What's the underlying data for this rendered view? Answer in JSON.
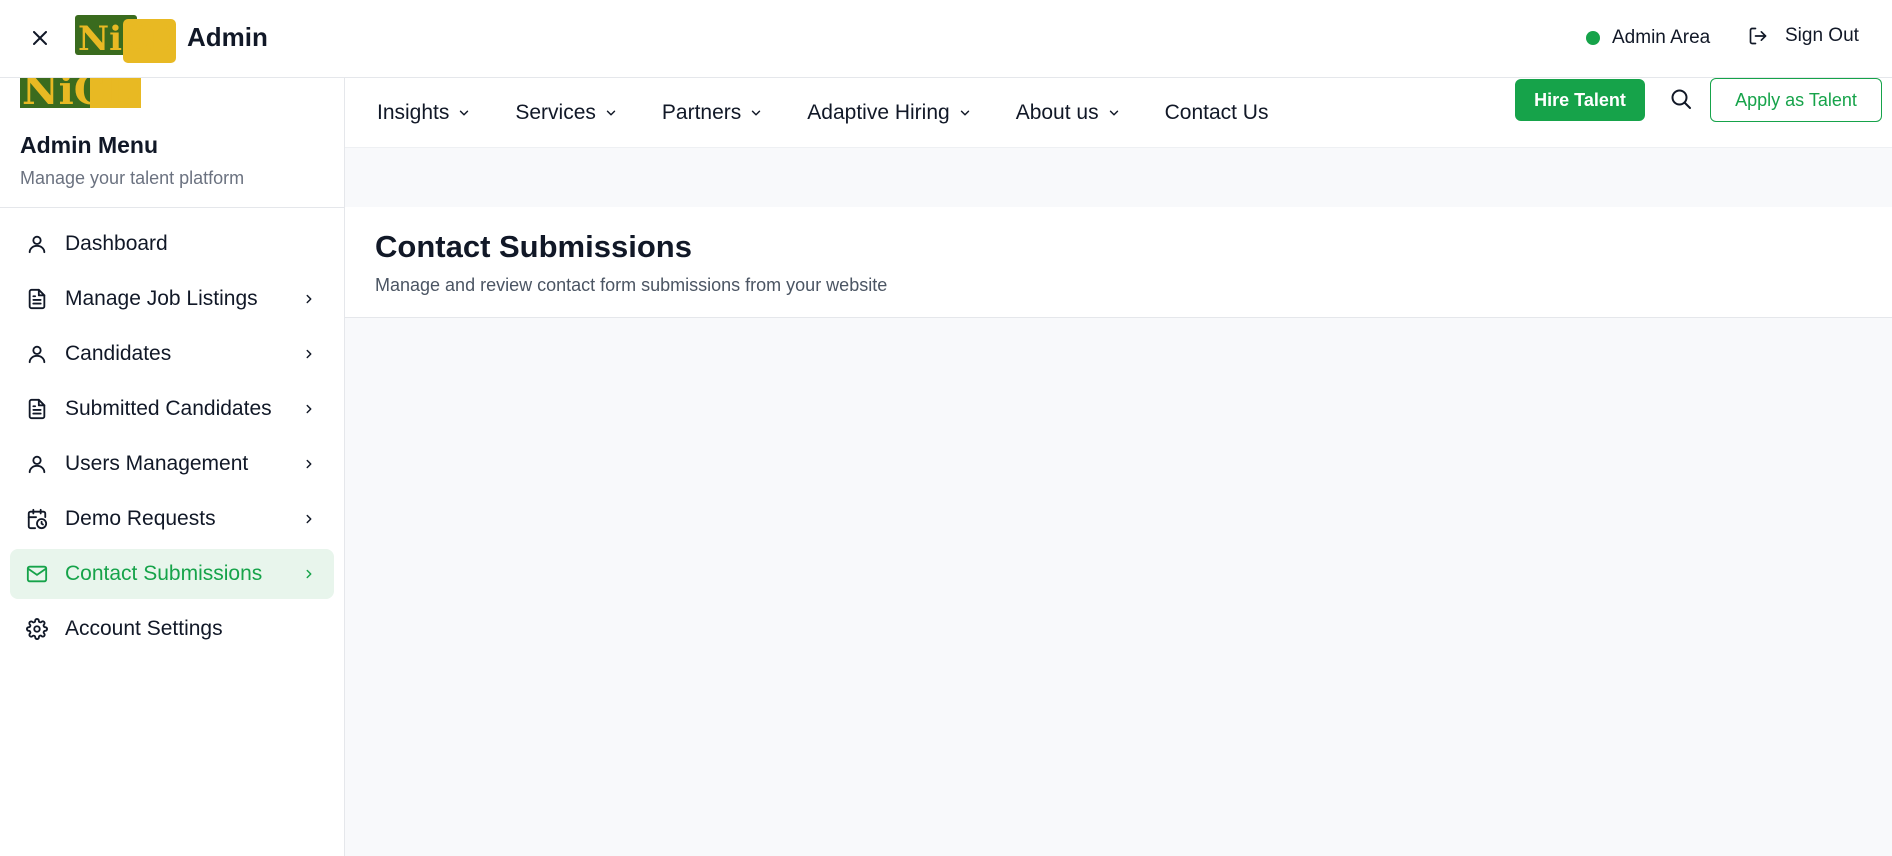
{
  "topbar": {
    "logo_text": "NiCDiK",
    "title": "Admin",
    "status_label": "Admin Area",
    "signout_label": "Sign Out",
    "status_color": "#16a34a"
  },
  "nav": {
    "items": [
      {
        "label": "Insights",
        "dropdown": true
      },
      {
        "label": "Services",
        "dropdown": true
      },
      {
        "label": "Partners",
        "dropdown": true
      },
      {
        "label": "Adaptive Hiring",
        "dropdown": true
      },
      {
        "label": "About us",
        "dropdown": true
      },
      {
        "label": "Contact Us",
        "dropdown": false
      }
    ],
    "hire_label": "Hire Talent",
    "apply_label": "Apply as Talent"
  },
  "sidebar": {
    "title": "Admin Menu",
    "subtitle": "Manage your talent platform",
    "items": [
      {
        "label": "Dashboard",
        "icon": "user-icon",
        "chevron": false,
        "active": false
      },
      {
        "label": "Manage Job Listings",
        "icon": "document-icon",
        "chevron": true,
        "active": false
      },
      {
        "label": "Candidates",
        "icon": "user-icon",
        "chevron": true,
        "active": false
      },
      {
        "label": "Submitted Candidates",
        "icon": "document-icon",
        "chevron": true,
        "active": false
      },
      {
        "label": "Users Management",
        "icon": "user-icon",
        "chevron": true,
        "active": false
      },
      {
        "label": "Demo Requests",
        "icon": "calendar-clock-icon",
        "chevron": true,
        "active": false
      },
      {
        "label": "Contact Submissions",
        "icon": "mail-icon",
        "chevron": true,
        "active": true
      },
      {
        "label": "Account Settings",
        "icon": "gear-icon",
        "chevron": false,
        "active": false
      }
    ]
  },
  "main": {
    "title": "Contact Submissions",
    "subtitle": "Manage and review contact form submissions from your website"
  },
  "colors": {
    "accent": "#16a34a",
    "active_bg": "#e8f5ec",
    "logo_green": "#3a6b1e",
    "logo_yellow": "#e8b923"
  }
}
